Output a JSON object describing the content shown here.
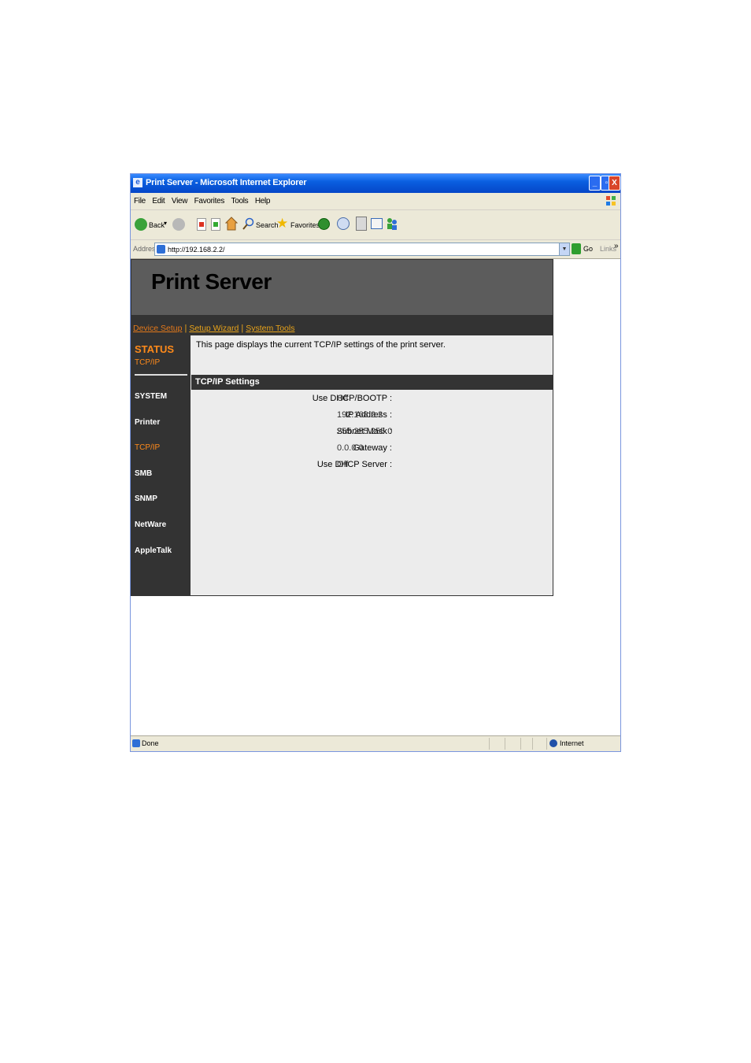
{
  "window": {
    "title": "Print Server - Microsoft Internet Explorer",
    "buttons": {
      "minimize": "_",
      "maximize": "▫",
      "close": "X"
    }
  },
  "menu": [
    "File",
    "Edit",
    "View",
    "Favorites",
    "Tools",
    "Help"
  ],
  "toolbar": {
    "back": "Back",
    "search": "Search",
    "favorites": "Favorites"
  },
  "address": {
    "label": "Address",
    "url": "http://192.168.2.2/",
    "go": "Go",
    "links": "Links",
    "chevron": "»"
  },
  "page": {
    "banner_title": "Print Server",
    "nav": [
      "Device Setup",
      "Setup Wizard",
      "System Tools"
    ],
    "nav_sep": "|",
    "sidebar": {
      "status": "STATUS",
      "status_sub": "TCP/IP",
      "items": [
        "SYSTEM",
        "Printer",
        "TCP/IP",
        "SMB",
        "SNMP",
        "NetWare",
        "AppleTalk"
      ]
    },
    "description": "This page displays the current TCP/IP settings of the print server.",
    "section_title": "TCP/IP Settings",
    "settings": [
      {
        "label": "Use DHCP/BOOTP :",
        "value": "Off"
      },
      {
        "label": "IP Address :",
        "value": "192.168.2.2"
      },
      {
        "label": "Subnet Mask :",
        "value": "255.255.255.0"
      },
      {
        "label": "Gateway :",
        "value": "0.0.0.0"
      },
      {
        "label": "Use DHCP Server :",
        "value": "Off"
      }
    ]
  },
  "status": {
    "text": "Done",
    "zone": "Internet"
  }
}
